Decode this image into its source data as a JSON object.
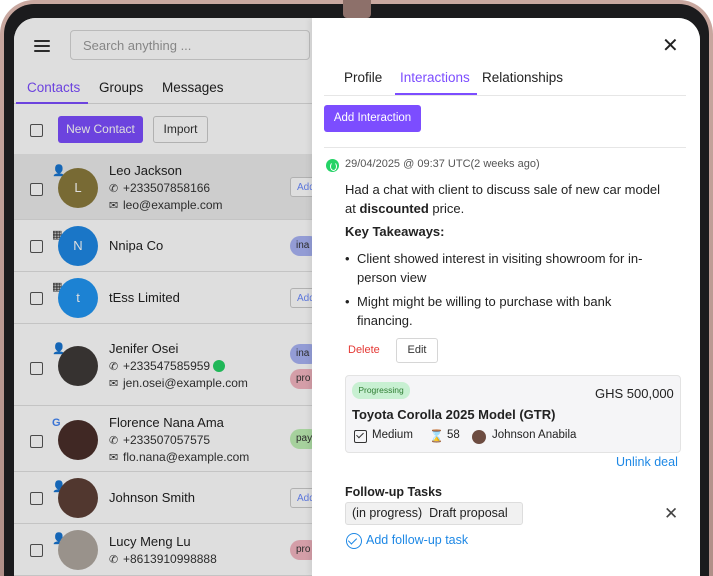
{
  "left_panel": {
    "search_placeholder": "Search anything ...",
    "tabs": [
      {
        "label": "Contacts",
        "active": true
      },
      {
        "label": "Groups",
        "active": false
      },
      {
        "label": "Messages",
        "active": false
      }
    ],
    "toolbar": {
      "new_contact_label": "New Contact",
      "import_label": "Import"
    },
    "contacts": [
      {
        "name": "Leo Jackson",
        "phone": "+233507858166",
        "email": "leo@example.com",
        "avatar_text": "L",
        "avatar_color": "#8a7a3c",
        "type_icon": "person-icon",
        "pill": "Add",
        "pill_style": "outline",
        "selected": true
      },
      {
        "name": "Nnipa Co",
        "phone": "",
        "email": "",
        "avatar_text": "N",
        "avatar_color": "#1e88e5",
        "type_icon": "building-icon",
        "pill": "ina",
        "pill_color": "#a9b4f5",
        "selected": false
      },
      {
        "name": "tEss Limited",
        "phone": "",
        "email": "",
        "avatar_text": "t",
        "avatar_color": "#2196f3",
        "type_icon": "building-icon",
        "pill": "Add",
        "pill_style": "outline",
        "selected": false
      },
      {
        "name": "Jenifer Osei",
        "phone": "+233547585959",
        "email": "jen.osei@example.com",
        "avatar_text": "",
        "avatar_color": "#3e3a38",
        "type_icon": "person-icon",
        "pill": "ina",
        "pill_color": "#a9b4f5",
        "pill2": "pro",
        "pill2_color": "#f4b6c2",
        "has_whatsapp": true,
        "selected": false
      },
      {
        "name": "Florence Nana Ama",
        "phone": "+233507057575",
        "email": "flo.nana@example.com",
        "avatar_text": "",
        "avatar_color": "#4a2f2a",
        "type_icon": "google-icon",
        "pill": "pay",
        "pill_color": "#bff0b5",
        "selected": false
      },
      {
        "name": "Johnson Smith",
        "phone": "",
        "email": "",
        "avatar_text": "",
        "avatar_color": "#5d4037",
        "type_icon": "person-icon",
        "pill": "Add",
        "pill_style": "outline",
        "selected": false
      },
      {
        "name": "Lucy Meng Lu",
        "phone": "+8613910998888",
        "email": "",
        "avatar_text": "",
        "avatar_color": "#b0a8a0",
        "type_icon": "person-icon",
        "pill": "pro",
        "pill_color": "#f4b6c2",
        "selected": false
      }
    ]
  },
  "right_panel": {
    "tabs": [
      {
        "label": "Profile",
        "active": false
      },
      {
        "label": "Interactions",
        "active": true
      },
      {
        "label": "Relationships",
        "active": false
      }
    ],
    "add_interaction_label": "Add Interaction",
    "interaction": {
      "channel_icon": "whatsapp-icon",
      "timestamp": "29/04/2025 @ 09:37 UTC(2 weeks ago)",
      "summary_line1": "Had a chat with client to discuss sale of new car model",
      "summary_line2_pre": "at ",
      "summary_line2_bold": "discounted",
      "summary_line2_post": " price.",
      "takeaways_title": "Key Takeaways:",
      "takeaways": [
        {
          "line1": "Client showed interest in visiting showroom for in-",
          "line2": "person view"
        },
        {
          "line1": "Might might be willing to purchase with bank",
          "line2": "financing."
        }
      ],
      "delete_label": "Delete",
      "edit_label": "Edit"
    },
    "deal": {
      "status": "Progressing",
      "price": "GHS 500,000",
      "title": "Toyota Corolla 2025 Model (GTR)",
      "priority": "Medium",
      "score": "58",
      "owner": "Johnson Anabila",
      "unlink_label": "Unlink deal"
    },
    "follow_up": {
      "title": "Follow-up Tasks",
      "tasks": [
        {
          "status": "(in progress)",
          "label": "Draft proposal"
        }
      ],
      "add_label": "Add follow-up task"
    }
  },
  "colors": {
    "accent": "#7c4dff",
    "link": "#1e88e5",
    "danger": "#e53935",
    "whatsapp": "#25d366"
  }
}
